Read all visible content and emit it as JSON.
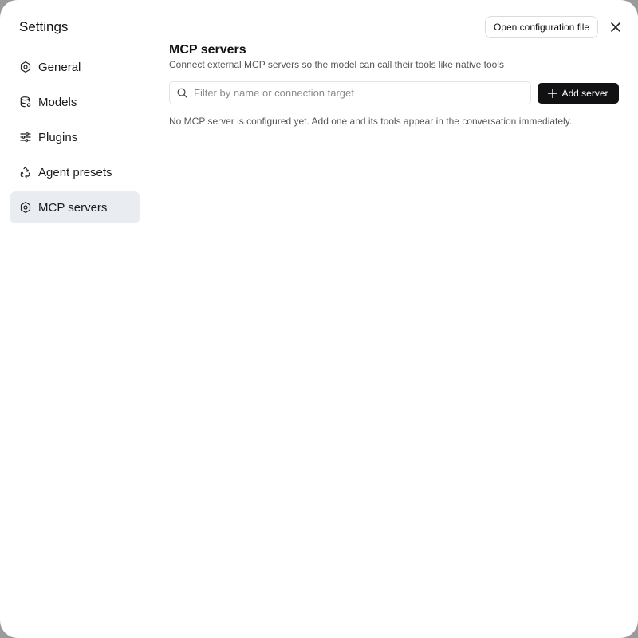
{
  "sidebar": {
    "title": "Settings",
    "items": [
      {
        "label": "General",
        "icon": "gear-icon",
        "active": false
      },
      {
        "label": "Models",
        "icon": "database-icon",
        "active": false
      },
      {
        "label": "Plugins",
        "icon": "sliders-icon",
        "active": false
      },
      {
        "label": "Agent presets",
        "icon": "recycle-icon",
        "active": false
      },
      {
        "label": "MCP servers",
        "icon": "gear-icon",
        "active": true
      }
    ]
  },
  "header": {
    "open_config_label": "Open configuration file",
    "close_icon": "close-icon"
  },
  "main": {
    "title": "MCP servers",
    "subtitle": "Connect external MCP servers so the model can call their tools like native tools",
    "search": {
      "placeholder": "Filter by name or connection target",
      "value": ""
    },
    "add_server_label": "Add server",
    "empty_message": "No MCP server is configured yet. Add one and its tools appear in the conversation immediately."
  },
  "colors": {
    "active_item_bg": "#e9ecf0",
    "primary_button": "#111113"
  }
}
